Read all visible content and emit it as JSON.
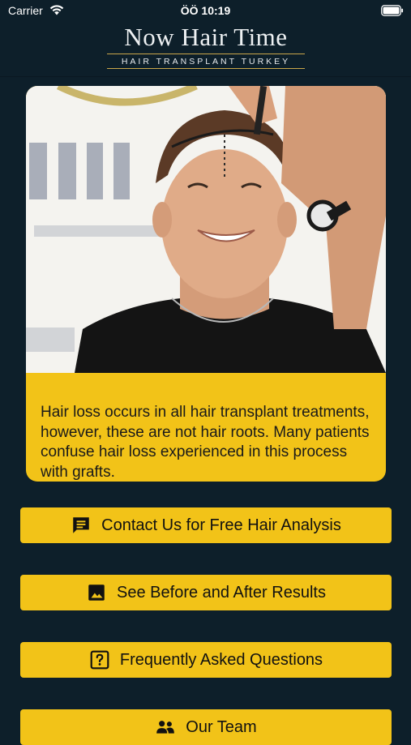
{
  "status_bar": {
    "carrier": "Carrier",
    "time": "ÖÖ 10:19"
  },
  "header": {
    "logo_title": "Now Hair Time",
    "logo_subtitle": "HAIR TRANSPLANT TURKEY"
  },
  "hero": {
    "text": "Hair loss occurs in all hair transplant treatments, however, these are not hair roots. Many patients confuse hair loss experienced in this process with grafts."
  },
  "buttons": {
    "contact": {
      "label": "Contact Us for Free Hair Analysis",
      "icon": "chat-icon"
    },
    "results": {
      "label": "See Before and After Results",
      "icon": "image-icon"
    },
    "faq": {
      "label": "Frequently Asked Questions",
      "icon": "question-icon"
    },
    "team": {
      "label": "Our Team",
      "icon": "people-icon"
    }
  },
  "colors": {
    "background": "#0d1f2a",
    "accent": "#f2c318",
    "logo_gold": "#c9a64a"
  }
}
